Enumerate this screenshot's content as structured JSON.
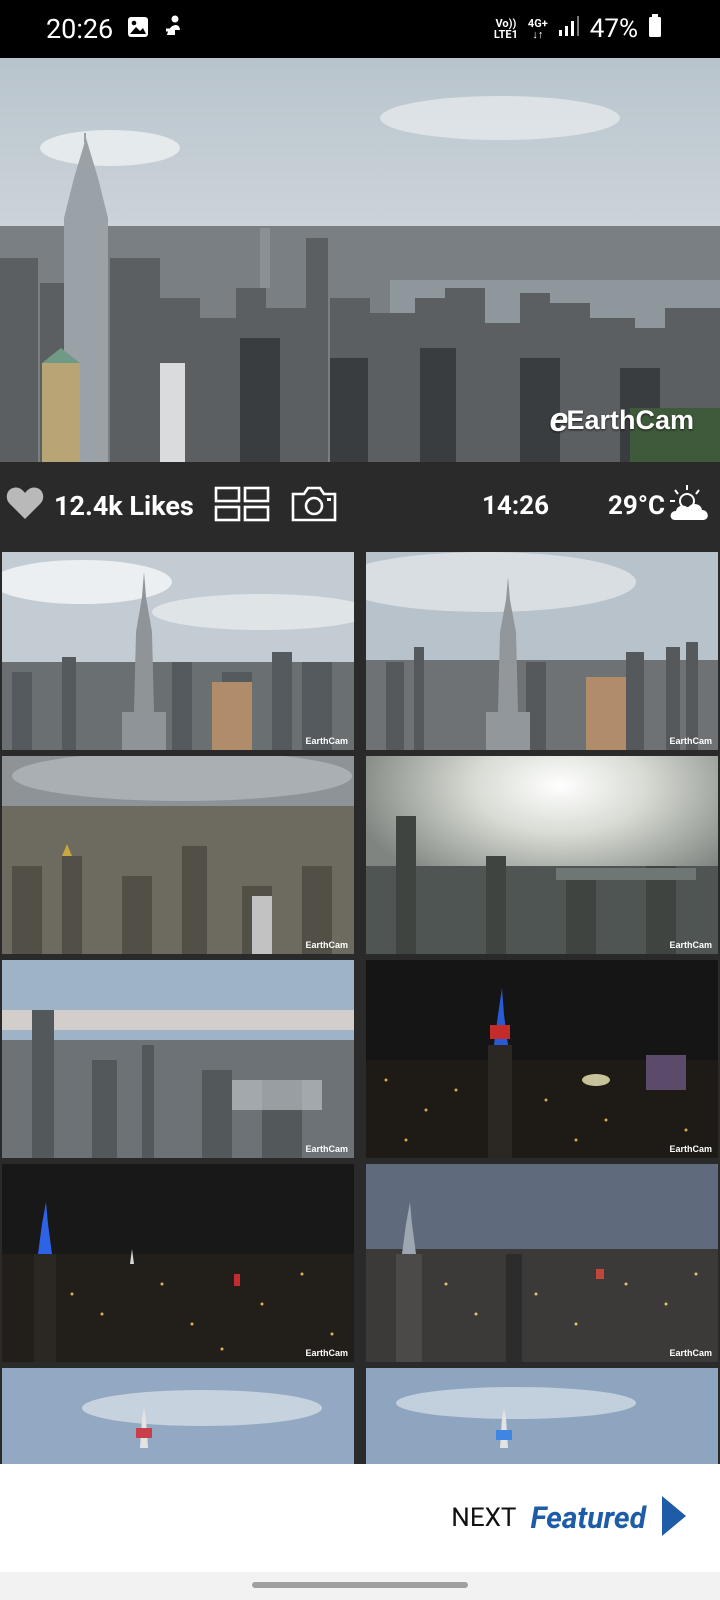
{
  "status_bar": {
    "time": "20:26",
    "volte": "Vo))\nLTE1",
    "network": "4G+",
    "battery": "47%",
    "icons": [
      "image-icon",
      "app-notification-icon",
      "signal-icon",
      "battery-icon"
    ]
  },
  "hero": {
    "logo_text": "EarthCam"
  },
  "action_bar": {
    "likes_label": "12.4k Likes",
    "time": "14:26",
    "temperature": "29°C",
    "icons": [
      "heart-icon",
      "grid-view-icon",
      "camera-icon",
      "partly-cloudy-icon"
    ]
  },
  "tiles": [
    {
      "logo": "EarthCam",
      "scene": "day-empire"
    },
    {
      "logo": "EarthCam",
      "scene": "day-empire"
    },
    {
      "logo": "EarthCam",
      "scene": "hazy-downtown"
    },
    {
      "logo": "EarthCam",
      "scene": "sun-haze"
    },
    {
      "logo": "EarthCam",
      "scene": "dusk-skyline"
    },
    {
      "logo": "EarthCam",
      "scene": "night-empire"
    },
    {
      "logo": "EarthCam",
      "scene": "night-city"
    },
    {
      "logo": "EarthCam",
      "scene": "evening-skyline"
    },
    {
      "logo": "",
      "scene": "sky-top"
    },
    {
      "logo": "",
      "scene": "sky-top"
    }
  ],
  "footer": {
    "next_label": "NEXT",
    "featured_label": "Featured"
  },
  "colors": {
    "accent": "#1f5ca8",
    "background": "#2a2a2a",
    "footer_bg": "#ffffff"
  }
}
